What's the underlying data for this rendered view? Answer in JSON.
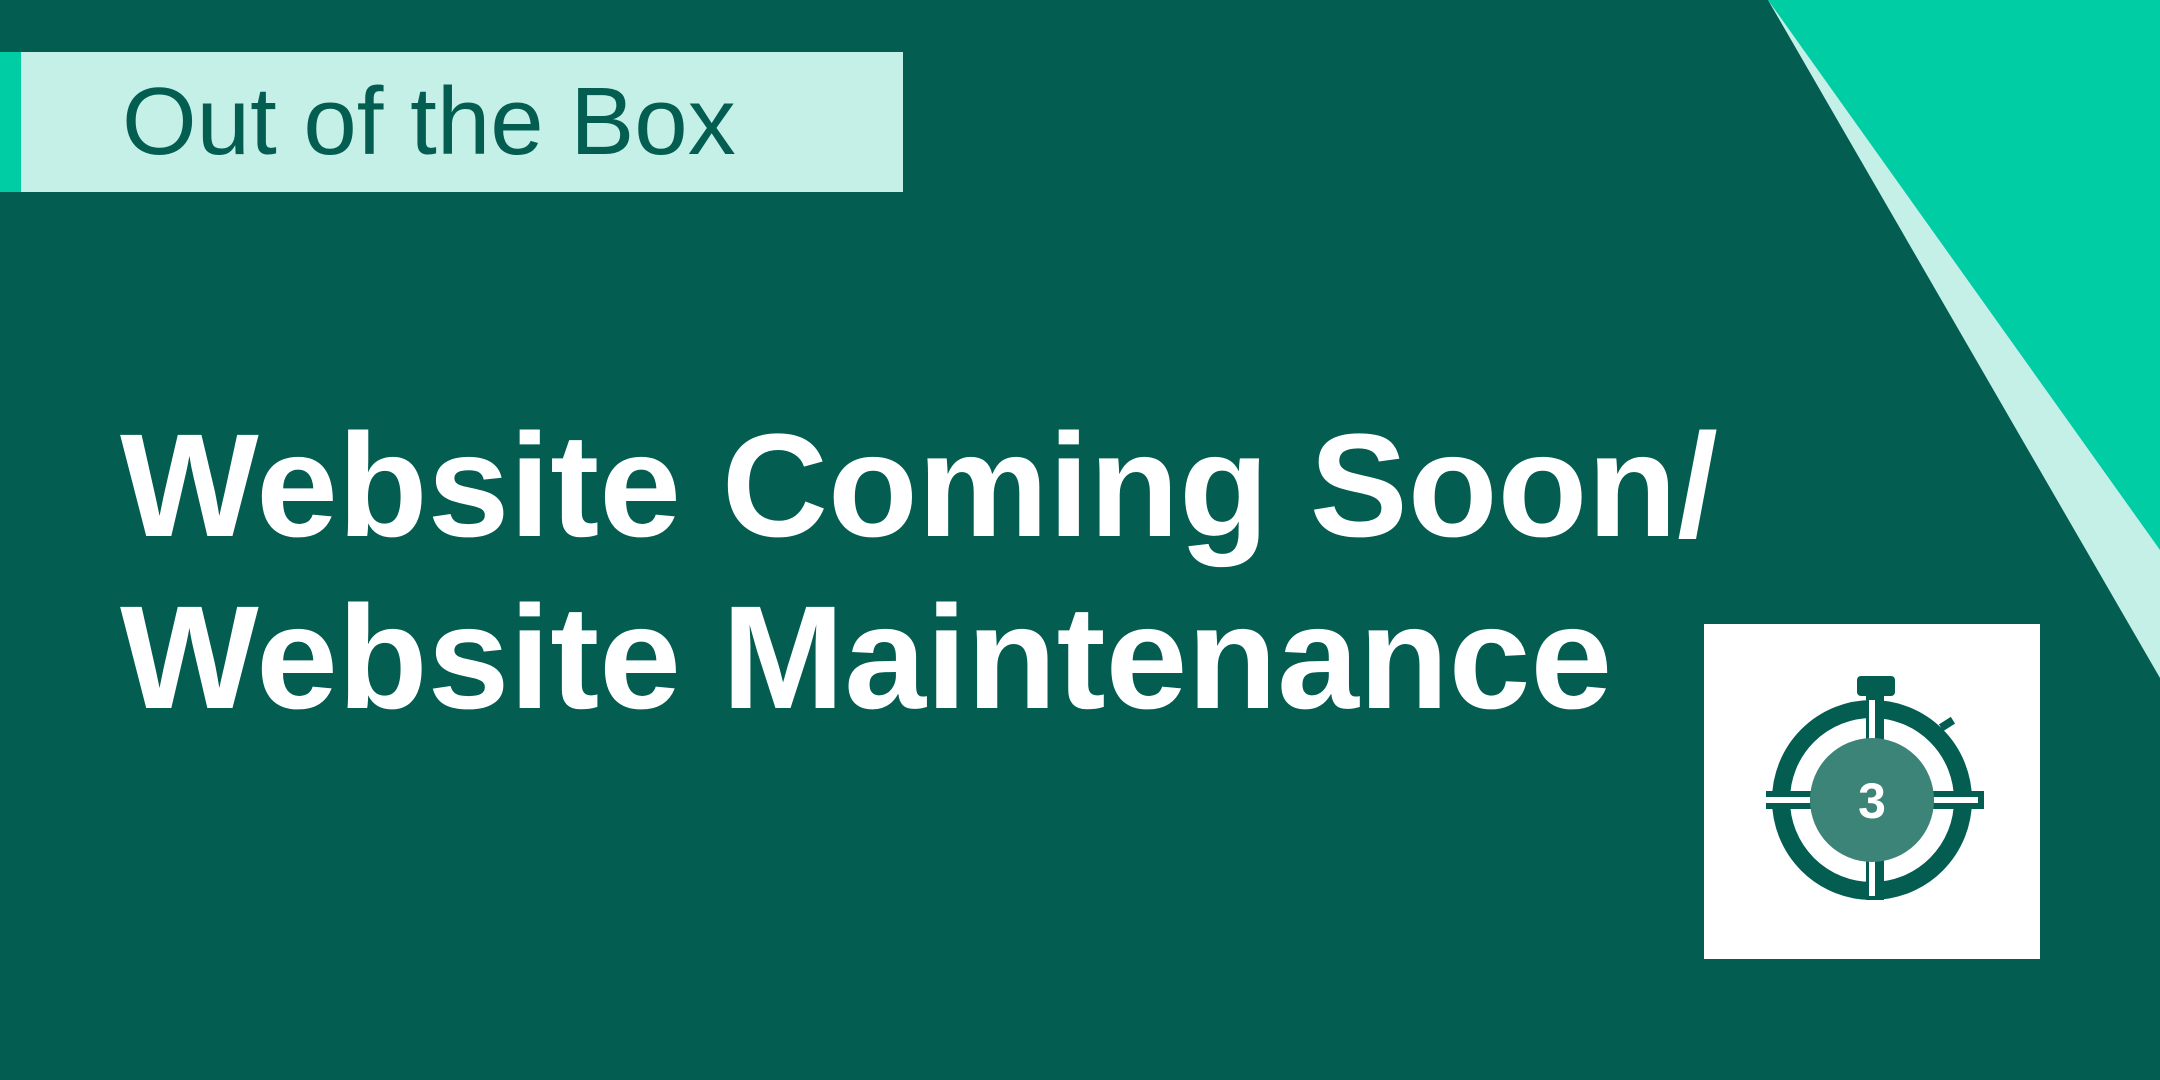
{
  "tag": {
    "label": "Out of the Box"
  },
  "headline": {
    "line1": "Website Coming Soon/",
    "line2": "Website Maintenance"
  },
  "timer_icon": {
    "icon": "stopwatch-crosshair-icon",
    "number": "3"
  },
  "colors": {
    "background": "#035e51",
    "accent": "#00cda4",
    "tag_background": "#c4f0e8",
    "highlight": "#c4f0e8",
    "icon_fill": "#3d8478"
  }
}
